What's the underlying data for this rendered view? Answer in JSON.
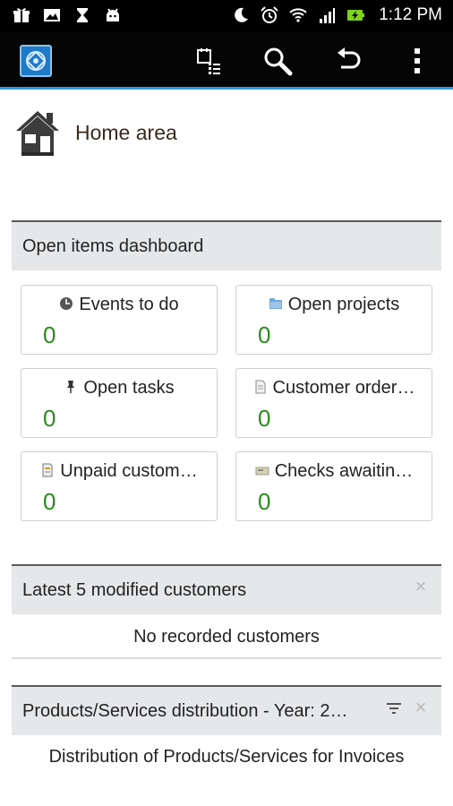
{
  "status_bar": {
    "time": "1:12 PM",
    "left_icons": [
      "gift-icon",
      "image-icon",
      "hourglass-icon",
      "android-icon"
    ],
    "right_icons": [
      "moon-icon",
      "alarm-icon",
      "wifi-icon",
      "signal-icon",
      "battery-charging-icon"
    ]
  },
  "action_bar": {
    "accent_color": "#2f9ad6",
    "icons": [
      "app-logo-icon",
      "calendar-list-icon",
      "search-icon",
      "undo-icon",
      "overflow-menu-icon"
    ]
  },
  "home": {
    "title": "Home area"
  },
  "dashboard": {
    "title": "Open items dashboard",
    "tiles": [
      {
        "label": "Events to do",
        "count": "0",
        "icon": "clock-icon"
      },
      {
        "label": "Open projects",
        "count": "0",
        "icon": "folder-icon"
      },
      {
        "label": "Open tasks",
        "count": "0",
        "icon": "pushpin-icon"
      },
      {
        "label": "Customer order…",
        "count": "0",
        "icon": "document-icon"
      },
      {
        "label": "Unpaid custom…",
        "count": "0",
        "icon": "invoice-icon"
      },
      {
        "label": "Checks awaitin…",
        "count": "0",
        "icon": "check-icon"
      }
    ]
  },
  "latest_customers": {
    "title": "Latest 5 modified customers",
    "empty_text": "No recorded customers"
  },
  "distribution": {
    "title": "Products/Services distribution - Year: 2…",
    "subtitle": "Distribution of Products/Services for Invoices"
  }
}
